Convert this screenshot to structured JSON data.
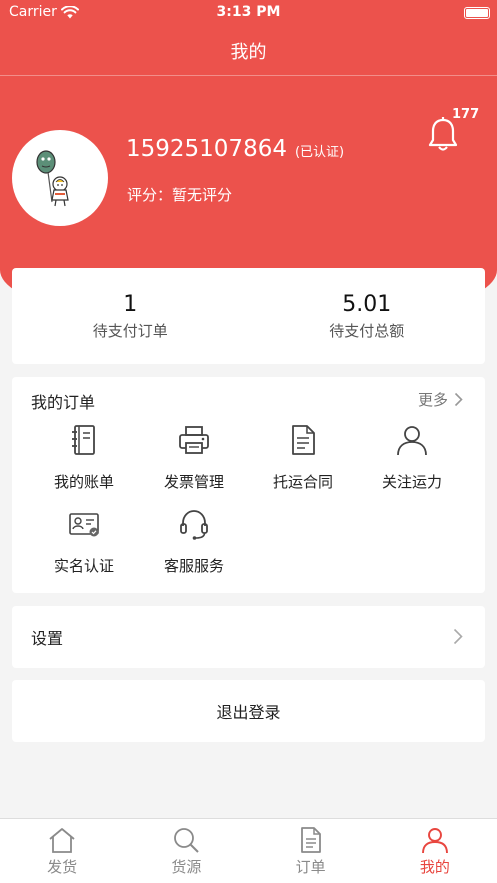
{
  "status_bar": {
    "carrier": "Carrier",
    "time": "3:13 PM"
  },
  "nav": {
    "title": "我的"
  },
  "profile": {
    "phone": "15925107864",
    "verified": "(已认证)",
    "rating_label": "评分：",
    "rating_value": "暂无评分",
    "notification_count": "177"
  },
  "stats": [
    {
      "value": "1",
      "label": "待支付订单"
    },
    {
      "value": "5.01",
      "label": "待支付总额"
    }
  ],
  "orders": {
    "title": "我的订单",
    "more": "更多",
    "items": [
      {
        "label": "我的账单",
        "icon": "notebook-icon"
      },
      {
        "label": "发票管理",
        "icon": "printer-icon"
      },
      {
        "label": "托运合同",
        "icon": "document-icon"
      },
      {
        "label": "关注运力",
        "icon": "person-icon"
      },
      {
        "label": "实名认证",
        "icon": "id-card-icon"
      },
      {
        "label": "客服服务",
        "icon": "headset-icon"
      }
    ]
  },
  "settings": {
    "label": "设置"
  },
  "logout": {
    "label": "退出登录"
  },
  "tabs": [
    {
      "label": "发货",
      "icon": "home-icon",
      "active": false
    },
    {
      "label": "货源",
      "icon": "search-icon",
      "active": false
    },
    {
      "label": "订单",
      "icon": "document-icon",
      "active": false
    },
    {
      "label": "我的",
      "icon": "person-icon",
      "active": true
    }
  ],
  "colors": {
    "brand": "#ec524c",
    "active_tab": "#e8463f",
    "background": "#f4f4f4"
  }
}
